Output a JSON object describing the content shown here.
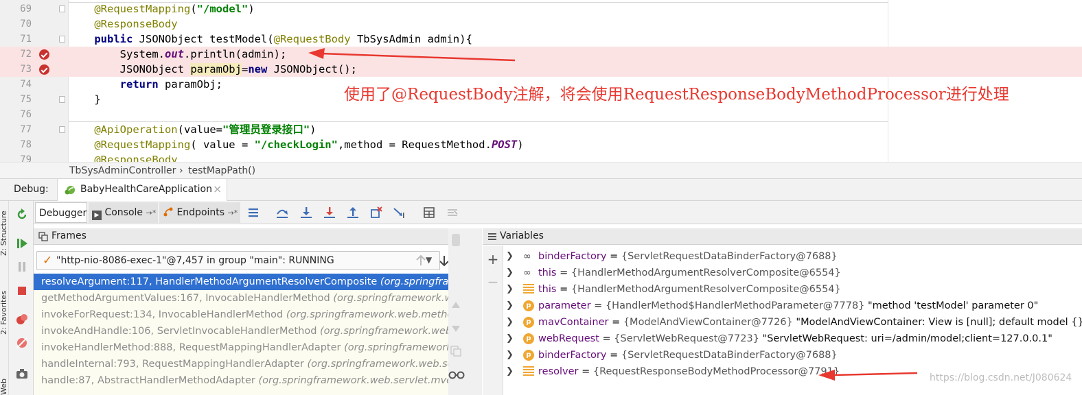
{
  "editor": {
    "lines": [
      {
        "num": "69",
        "segments": [
          {
            "t": "    "
          },
          {
            "t": "@RequestMapping",
            "c": "ann"
          },
          {
            "t": "("
          },
          {
            "t": "\"/model\"",
            "c": "str"
          },
          {
            "t": ")"
          }
        ]
      },
      {
        "num": "70",
        "segments": [
          {
            "t": "    "
          },
          {
            "t": "@ResponseBody",
            "c": "ann"
          }
        ]
      },
      {
        "num": "71",
        "segments": [
          {
            "t": "    "
          },
          {
            "t": "public ",
            "c": "kw"
          },
          {
            "t": "JSONObject testModel("
          },
          {
            "t": "@RequestBody",
            "c": "ann"
          },
          {
            "t": " TbSysAdmin admin){"
          }
        ]
      },
      {
        "num": "72",
        "breakpoint": true,
        "segments": [
          {
            "t": "        System."
          },
          {
            "t": "out",
            "c": "stat"
          },
          {
            "t": ".println(admin);"
          }
        ]
      },
      {
        "num": "73",
        "breakpoint": true,
        "segments": [
          {
            "t": "        JSONObject "
          },
          {
            "t": "paramObj",
            "c": "hl"
          },
          {
            "t": "="
          },
          {
            "t": "new ",
            "c": "kw"
          },
          {
            "t": "JSONObject();"
          }
        ]
      },
      {
        "num": "74",
        "segments": [
          {
            "t": "        "
          },
          {
            "t": "return ",
            "c": "kw"
          },
          {
            "t": "paramObj;"
          }
        ]
      },
      {
        "num": "75",
        "segments": [
          {
            "t": "    }"
          }
        ]
      },
      {
        "num": "76",
        "segments": [
          {
            "t": ""
          }
        ]
      },
      {
        "num": "77",
        "segments": [
          {
            "t": "    "
          },
          {
            "t": "@ApiOperation",
            "c": "ann"
          },
          {
            "t": "(value="
          },
          {
            "t": "\"管理员登录接口\"",
            "c": "str"
          },
          {
            "t": ")"
          }
        ]
      },
      {
        "num": "78",
        "segments": [
          {
            "t": "    "
          },
          {
            "t": "@RequestMapping",
            "c": "ann"
          },
          {
            "t": "( value = "
          },
          {
            "t": "\"/checkLogin\"",
            "c": "str"
          },
          {
            "t": ",method = RequestMethod."
          },
          {
            "t": "POST",
            "c": "stat"
          },
          {
            "t": ")"
          }
        ]
      },
      {
        "num": "79",
        "segments": [
          {
            "t": "    "
          },
          {
            "t": "@ResponseBody",
            "c": "ann"
          }
        ]
      }
    ],
    "annotation_note": "使用了@RequestBody注解，将会使用RequestResponseBodyMethodProcessor进行处理"
  },
  "breadcrumb": {
    "class_name": "TbSysAdminController",
    "separator": "›",
    "method_name": "testMapPath()"
  },
  "debug": {
    "title": "Debug:",
    "run_tab": "BabyHealthCareApplication",
    "close_glyph": "×",
    "stripe_labels": [
      "Z: Structure",
      "2: Favorites",
      "Web"
    ],
    "tabs": {
      "debugger": "Debugger",
      "console": "Console",
      "endpoints": "Endpoints",
      "pin_suffix": "→*"
    }
  },
  "frames": {
    "title": "Frames",
    "pin": "→*",
    "thread": "\"http-nio-8086-exec-1\"@7,457 in group \"main\": RUNNING",
    "items": [
      {
        "method": "resolveArgument:117, HandlerMethodArgumentResolverComposite",
        "pkg": "(org.springframework.web.method.support)",
        "selected": true
      },
      {
        "method": "getMethodArgumentValues:167, InvocableHandlerMethod",
        "pkg": "(org.springframework.web.method.support)"
      },
      {
        "method": "invokeForRequest:134, InvocableHandlerMethod",
        "pkg": "(org.springframework.web.method.support)"
      },
      {
        "method": "invokeAndHandle:106, ServletInvocableHandlerMethod",
        "pkg": "(org.springframework.web.servlet.mvc.method.annotation)"
      },
      {
        "method": "invokeHandlerMethod:888, RequestMappingHandlerAdapter",
        "pkg": "(org.springframework.web.servlet.mvc.method.annotation)"
      },
      {
        "method": "handleInternal:793, RequestMappingHandlerAdapter",
        "pkg": "(org.springframework.web.servlet.mvc.method.annotation)"
      },
      {
        "method": "handle:87, AbstractHandlerMethodAdapter",
        "pkg": "(org.springframework.web.servlet.mvc.method)"
      }
    ]
  },
  "variables": {
    "title": "Variables",
    "items": [
      {
        "icon": "watch",
        "name": "binderFactory",
        "type": "{ServletRequestDataBinderFactory@7688}",
        "value": ""
      },
      {
        "icon": "watch",
        "name": "this",
        "type": "{HandlerMethodArgumentResolverComposite@6554}",
        "value": ""
      },
      {
        "icon": "list",
        "name": "this",
        "type": "{HandlerMethodArgumentResolverComposite@6554}",
        "value": ""
      },
      {
        "icon": "param",
        "name": "parameter",
        "type": "{HandlerMethod$HandlerMethodParameter@7778}",
        "value": "\"method 'testModel' parameter 0\""
      },
      {
        "icon": "param",
        "name": "mavContainer",
        "type": "{ModelAndViewContainer@7726}",
        "value": "\"ModelAndViewContainer: View is [null]; default model {}\""
      },
      {
        "icon": "param",
        "name": "webRequest",
        "type": "{ServletWebRequest@7723}",
        "value": "\"ServletWebRequest: uri=/admin/model;client=127.0.0.1\""
      },
      {
        "icon": "param",
        "name": "binderFactory",
        "type": "{ServletRequestDataBinderFactory@7688}",
        "value": ""
      },
      {
        "icon": "list",
        "name": "resolver",
        "type": "{RequestResponseBodyMethodProcessor@7791}",
        "value": ""
      }
    ],
    "eq": "="
  },
  "watermark": "https://blog.csdn.net/J080624",
  "colors": {
    "annotation_red": "#e8382f",
    "selection_blue": "#2f6fd0",
    "breakpoint_line": "#fbe3e4"
  }
}
